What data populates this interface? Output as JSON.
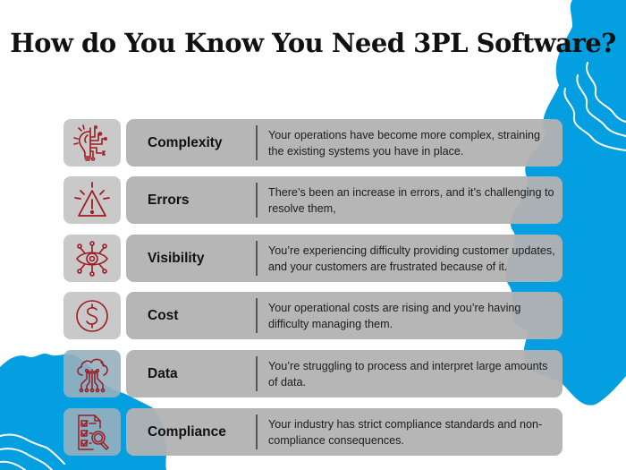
{
  "title": "How do You Know You Need 3PL Software?",
  "colors": {
    "accent_blue": "#039fe0",
    "icon_red": "#9e1b22",
    "card_gray": "#b2b2b2",
    "icon_box_gray": "#c0c0c0"
  },
  "items": [
    {
      "icon": "lightbulb-circuit-icon",
      "label": "Complexity",
      "description": "Your operations have become more complex, straining the existing systems you have in place."
    },
    {
      "icon": "warning-triangle-icon",
      "label": "Errors",
      "description": "There’s been an increase in errors, and it’s challenging to resolve them,"
    },
    {
      "icon": "eye-network-icon",
      "label": "Visibility",
      "description": "You’re experiencing difficulty providing customer updates, and your customers are frustrated because of it."
    },
    {
      "icon": "dollar-coin-icon",
      "label": "Cost",
      "description": "Your operational costs are rising and you’re having difficulty managing them."
    },
    {
      "icon": "cloud-data-icon",
      "label": "Data",
      "description": "You’re struggling to process and interpret large amounts of data."
    },
    {
      "icon": "checklist-magnifier-icon",
      "label": "Compliance",
      "description": "Your industry has strict compliance standards and non-compliance consequences."
    }
  ]
}
